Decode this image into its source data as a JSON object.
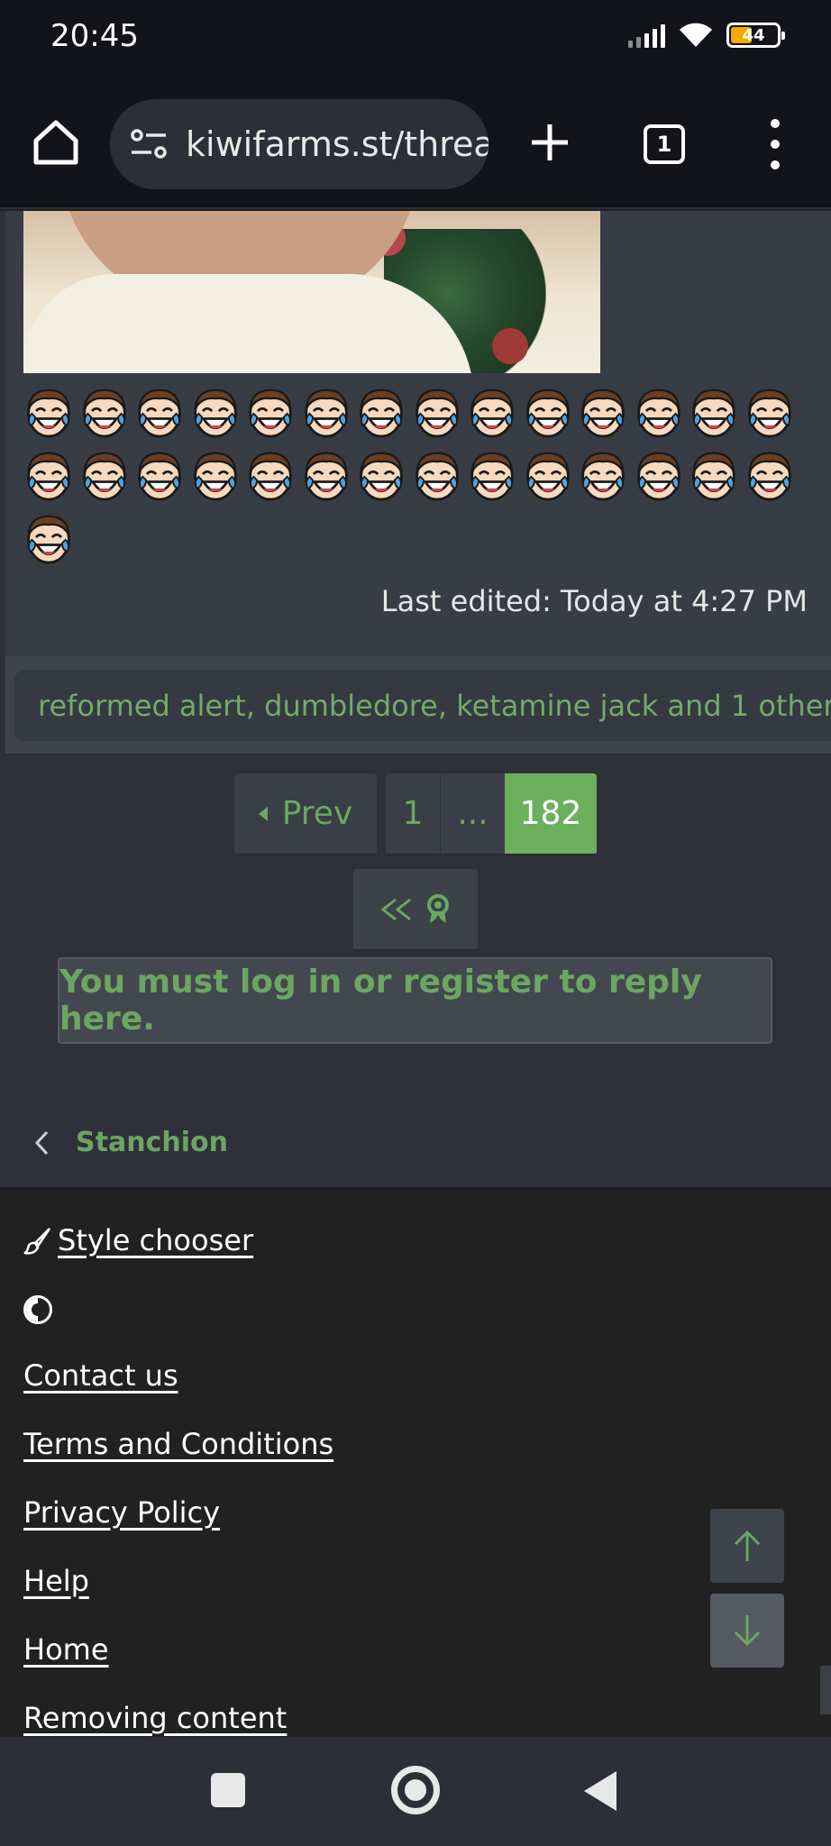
{
  "status_bar": {
    "time": "20:45",
    "battery_level": "44",
    "battery_fraction": 0.44,
    "signal_icon": "signal-icon",
    "wifi_icon": "wifi-icon"
  },
  "browser": {
    "url": "kiwifarms.st/threa",
    "tab_count": "1",
    "home_icon": "home-icon",
    "new_tab_icon": "plus-icon",
    "menu_icon": "more-vert-icon"
  },
  "post": {
    "reaction_emoji_icon": "laughing-crying-face-icon",
    "reaction_emoji_count": 29,
    "last_edited": "Last edited: Today at 4:27 PM"
  },
  "reactions": {
    "summary": "reformed alert, dumbledore, ketamine jack and 1 other"
  },
  "pagination": {
    "prev_label": "Prev",
    "first_page": "1",
    "ellipsis": "...",
    "current_page": "182"
  },
  "reply_notice": "You must log in or register to reply here.",
  "breadcrumb": {
    "label": "Stanchion"
  },
  "footer": {
    "style_chooser": "Style chooser",
    "links": [
      "Contact us",
      "Terms and Conditions",
      "Privacy Policy",
      "Help",
      "Home",
      "Removing content"
    ]
  },
  "colors": {
    "accent_green": "#6ca661",
    "current_page_bg": "#6cb05e",
    "battery_fill": "#f2a900",
    "page_bg": "#2e313a",
    "footer_bg": "#212121"
  }
}
